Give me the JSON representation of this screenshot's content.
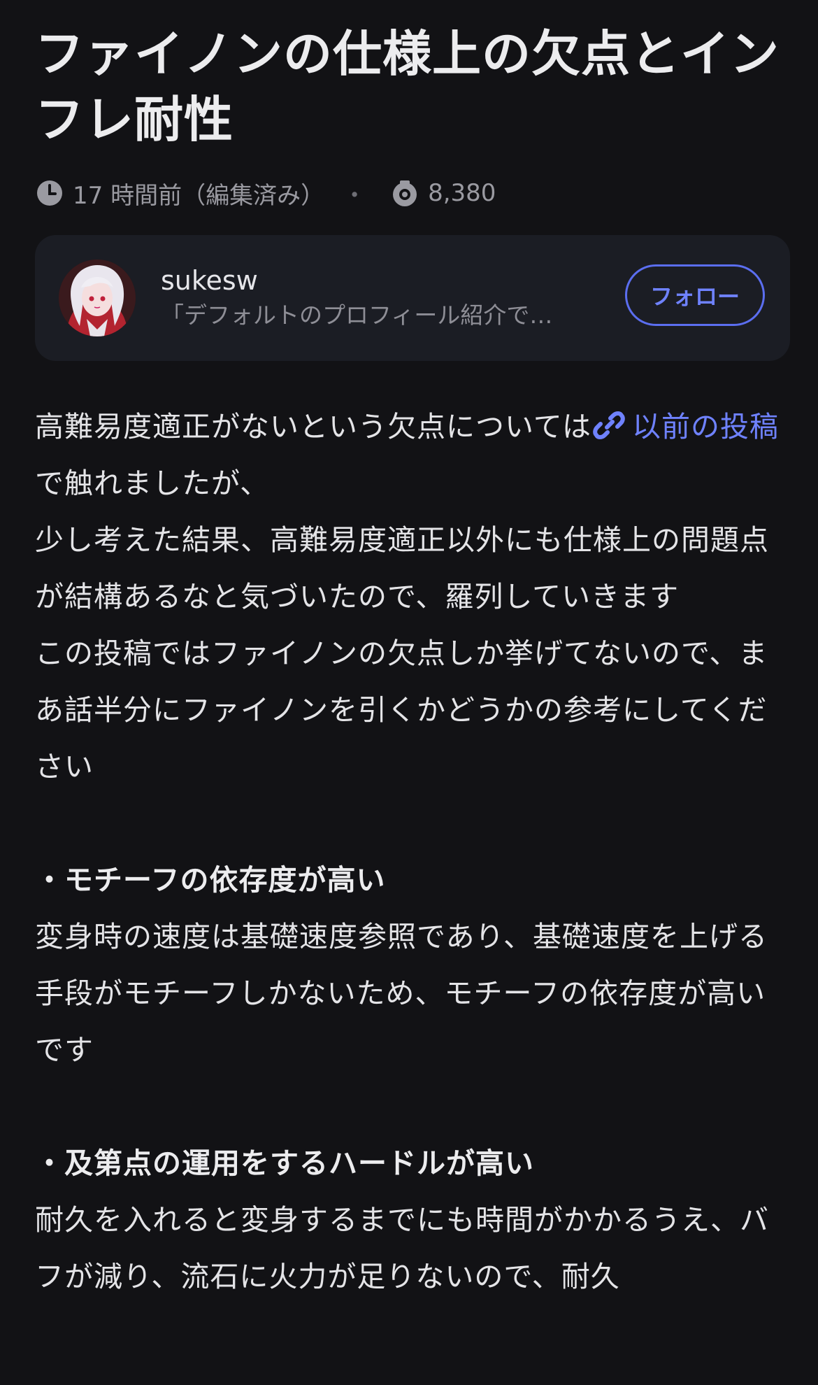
{
  "article": {
    "title": "ファイノンの仕様上の欠点とインフレ耐性",
    "time": "17 時間前（編集済み）",
    "separator": "・",
    "views": "8,380"
  },
  "author": {
    "name": "sukesw",
    "bio": "「デフォルトのプロフィール紹介で…",
    "follow_label": "フォロー"
  },
  "content": {
    "p1_before_link": "高難易度適正がないという欠点については",
    "link_text": "以前の投稿",
    "p1_after_link": "で触れましたが、",
    "p2": "少し考えた結果、高難易度適正以外にも仕様上の問題点が結構あるなと気づいたので、羅列していきます",
    "p3": "この投稿ではファイノンの欠点しか挙げてないので、まあ話半分にファイノンを引くかどうかの参考にしてください",
    "h1": "・モチーフの依存度が高い",
    "p4": "変身時の速度は基礎速度参照であり、基礎速度を上げる手段がモチーフしかないため、モチーフの依存度が高いです",
    "h2": "・及第点の運用をするハードルが高い",
    "p5": "耐久を入れると変身するまでにも時間がかかるうえ、バフが減り、流石に火力が足りないので、耐久"
  },
  "icons": {
    "time": "clock-icon",
    "views": "eye-icon",
    "link": "link-icon"
  },
  "colors": {
    "background": "#121215",
    "card": "#1b1d24",
    "accent": "#6f82ff",
    "text": "#e4e4e7",
    "muted": "#9a9aa1"
  }
}
